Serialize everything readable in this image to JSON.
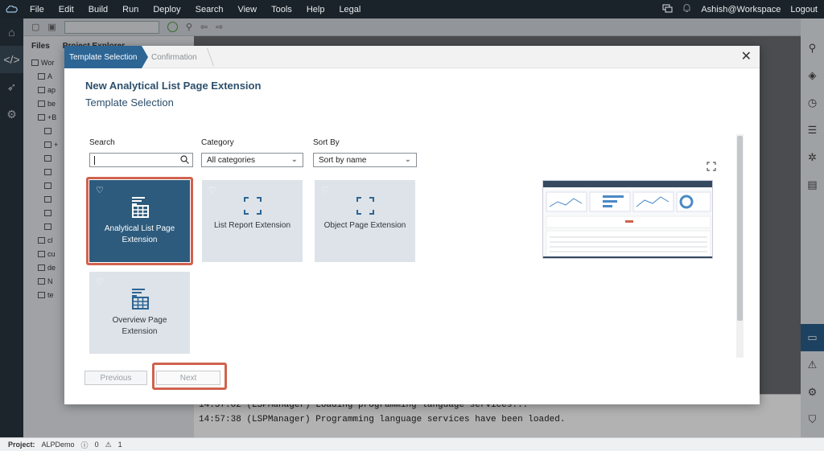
{
  "menubar": {
    "items": [
      "File",
      "Edit",
      "Build",
      "Run",
      "Deploy",
      "Search",
      "View",
      "Tools",
      "Help",
      "Legal"
    ],
    "user": "Ashish@Workspace",
    "logout": "Logout"
  },
  "files_panel": {
    "tabs": [
      "Files",
      "Project Explorer"
    ],
    "rows": [
      "Wor",
      "A",
      "ap",
      "be",
      "+B",
      "",
      "+",
      "",
      "",
      "",
      "",
      "",
      "",
      "cl",
      "cu",
      "de",
      "N",
      "te"
    ]
  },
  "console": {
    "lines": [
      "14:57:02 (LSPManager) Loading programming language services...",
      "14:57:38 (LSPManager) Programming language services have been loaded."
    ]
  },
  "statusbar": {
    "project_label": "Project:",
    "project_name": "ALPDemo",
    "errors": "0",
    "warnings": "1"
  },
  "dialog": {
    "steps": [
      "Template Selection",
      "Confirmation"
    ],
    "title": "New Analytical List Page Extension",
    "subtitle": "Template Selection",
    "search_label": "Search",
    "search_value": "",
    "category_label": "Category",
    "category_value": "All categories",
    "sortby_label": "Sort By",
    "sortby_value": "Sort by name",
    "tiles": [
      {
        "label": "Analytical List Page Extension",
        "icon": "table-list-icon",
        "selected": true
      },
      {
        "label": "List Report Extension",
        "icon": "frame-icon",
        "selected": false
      },
      {
        "label": "Object Page Extension",
        "icon": "frame-icon",
        "selected": false
      },
      {
        "label": "Overview Page Extension",
        "icon": "table-list-icon",
        "selected": false
      }
    ],
    "previous_label": "Previous",
    "next_label": "Next"
  },
  "colors": {
    "accent": "#2d6594",
    "selected_tile": "#2d5b7d",
    "highlight": "#d0624e"
  }
}
